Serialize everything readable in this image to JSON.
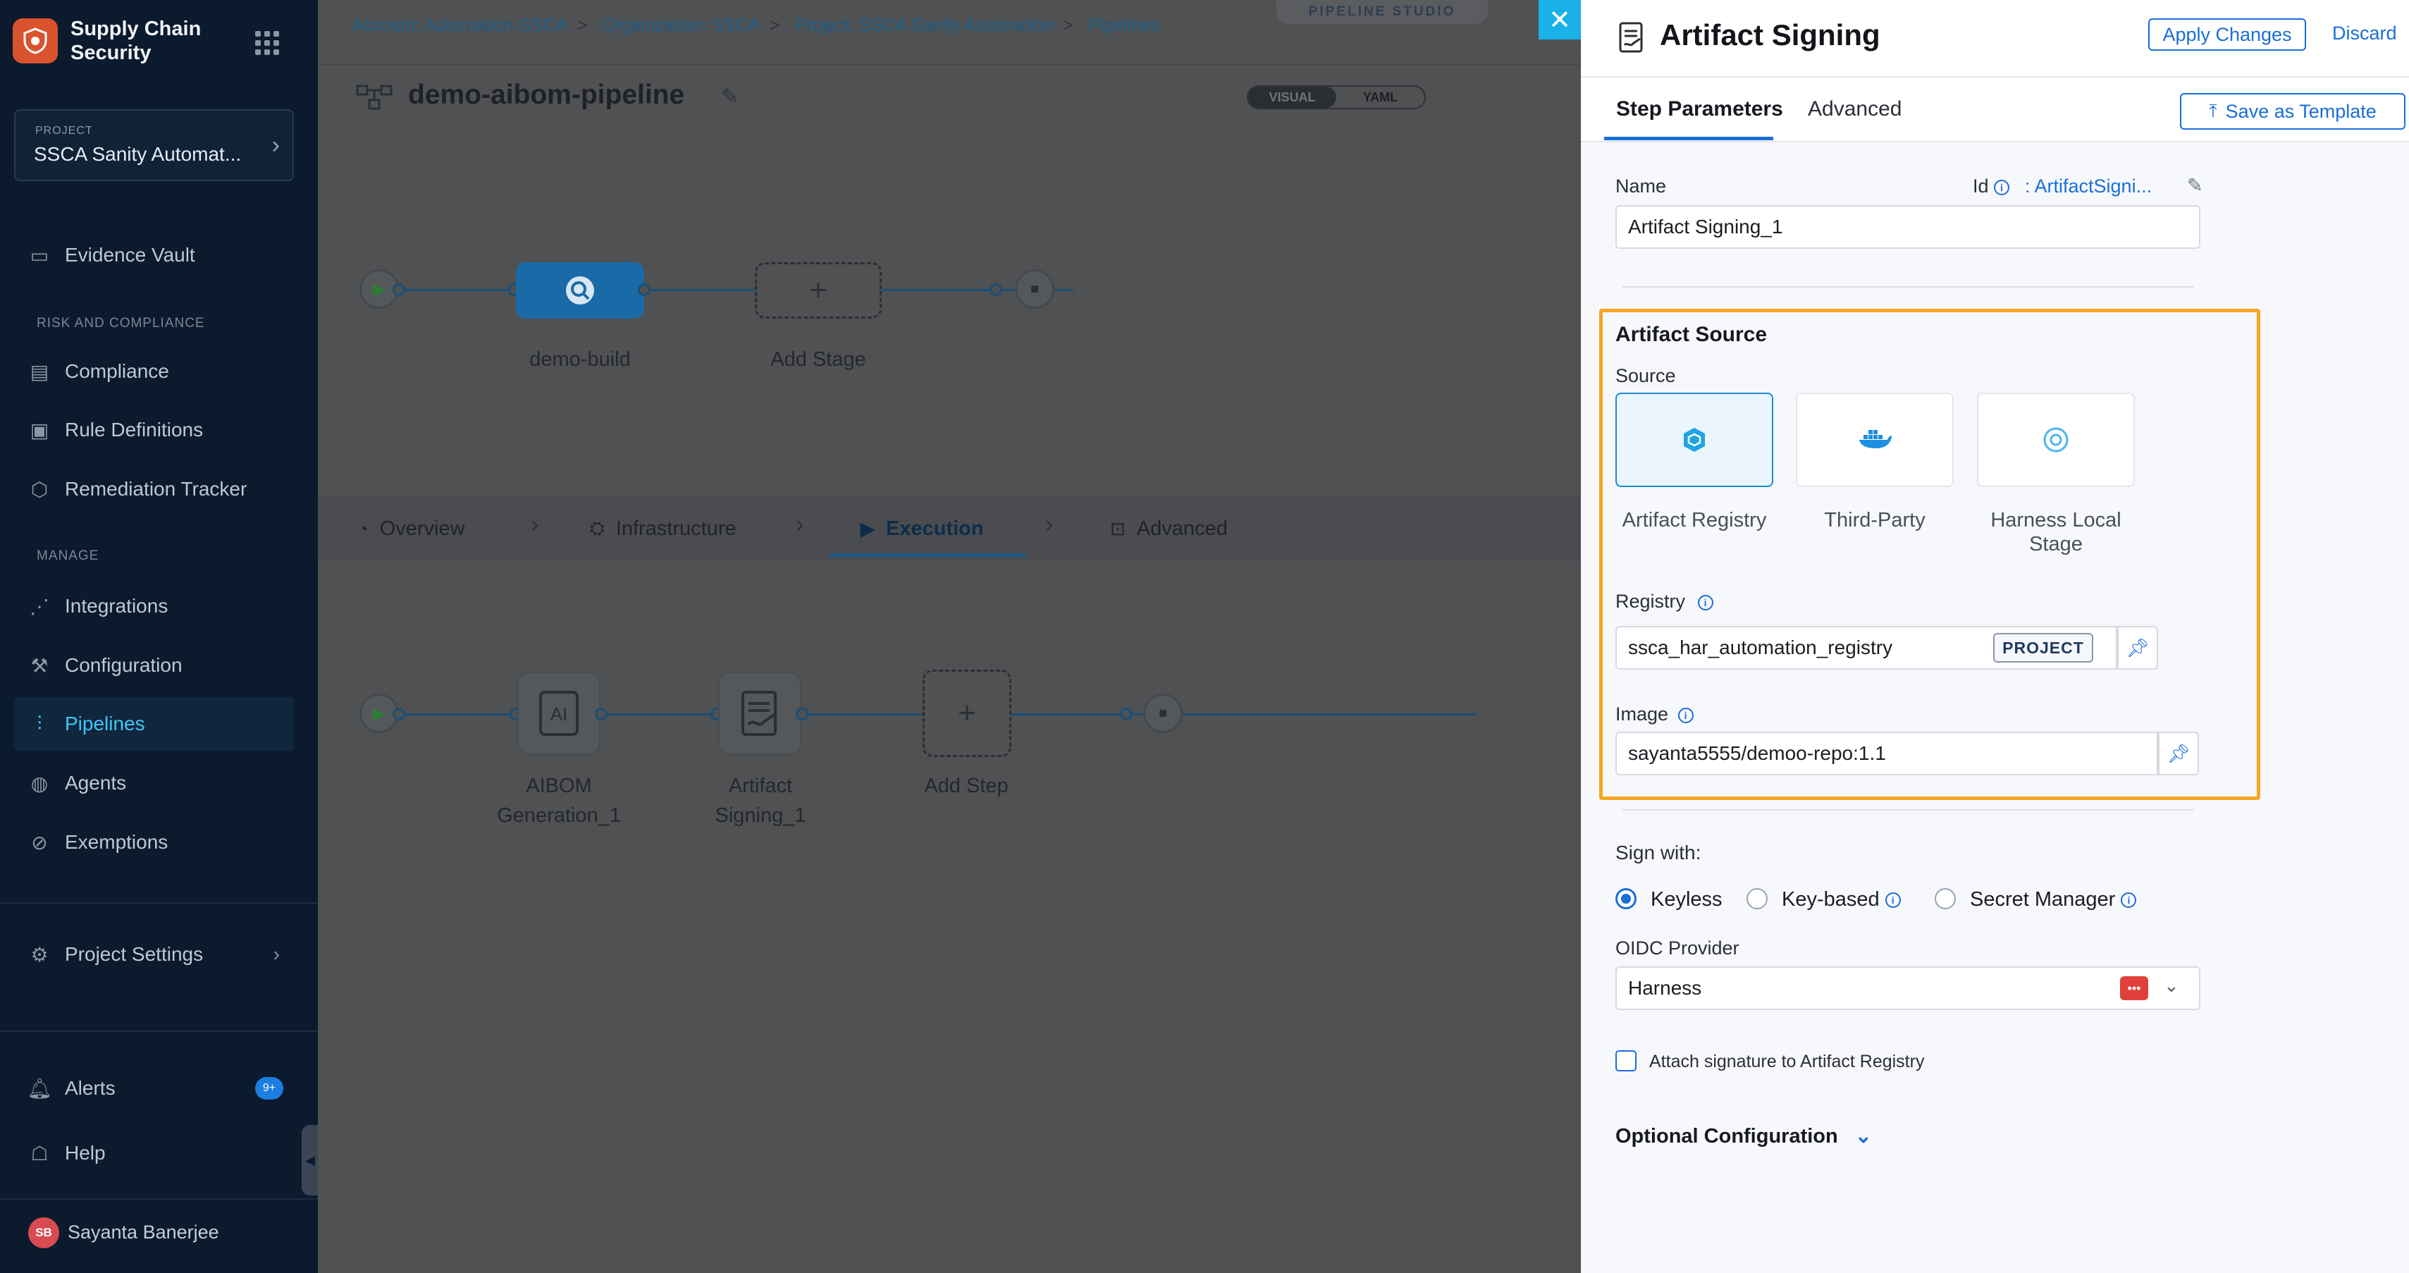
{
  "sidebar": {
    "brand_title": "Supply Chain Security",
    "project_kicker": "PROJECT",
    "project_name": "SSCA Sanity Automat...",
    "items": [
      {
        "label": "Evidence Vault"
      },
      {
        "label": "Compliance"
      },
      {
        "label": "Rule Definitions"
      },
      {
        "label": "Remediation Tracker"
      },
      {
        "label": "Integrations"
      },
      {
        "label": "Configuration"
      },
      {
        "label": "Pipelines"
      },
      {
        "label": "Agents"
      },
      {
        "label": "Exemptions"
      },
      {
        "label": "Project Settings"
      },
      {
        "label": "Alerts"
      },
      {
        "label": "Help"
      }
    ],
    "sections": {
      "risk": "RISK AND COMPLIANCE",
      "manage": "MANAGE"
    },
    "alerts_badge": "9+",
    "user_initials": "SB",
    "user_name": "Sayanta Banerjee"
  },
  "breadcrumb": [
    "Account: Automation-SSCA",
    "Organization: SSCA",
    "Project: SSCA Sanity Automation",
    "Pipelines"
  ],
  "studio_tag": "PIPELINE STUDIO",
  "pipeline": {
    "name": "demo-aibom-pipeline",
    "view_toggle": {
      "visual": "VISUAL",
      "yaml": "YAML"
    },
    "stages": [
      {
        "label": "demo-build"
      },
      {
        "label": "Add Stage"
      }
    ],
    "stage_tabs": [
      "Overview",
      "Infrastructure",
      "Execution",
      "Advanced"
    ],
    "steps": [
      {
        "label_line1": "AIBOM",
        "label_line2": "Generation_1"
      },
      {
        "label_line1": "Artifact",
        "label_line2": "Signing_1"
      },
      {
        "label_line1": "Add Step",
        "label_line2": ""
      }
    ]
  },
  "drawer": {
    "title": "Artifact Signing",
    "apply_label": "Apply Changes",
    "discard_label": "Discard",
    "tabs": [
      "Step Parameters",
      "Advanced"
    ],
    "save_template_label": "Save as Template",
    "name_label": "Name",
    "id_label": "Id",
    "id_value": ": ArtifactSigni...",
    "name_value": "Artifact Signing_1",
    "artifact_source": {
      "heading": "Artifact Source",
      "source_label": "Source",
      "options": [
        {
          "line1": "Artifact Registry",
          "line2": ""
        },
        {
          "line1": "Third-Party",
          "line2": ""
        },
        {
          "line1": "Harness Local",
          "line2": "Stage"
        }
      ],
      "registry_label": "Registry",
      "registry_value": "ssca_har_automation_registry",
      "registry_scope": "PROJECT",
      "image_label": "Image",
      "image_value": "sayanta5555/demoo-repo:1.1"
    },
    "sign_with_label": "Sign with:",
    "sign_options": [
      "Keyless",
      "Key-based",
      "Secret Manager"
    ],
    "oidc_label": "OIDC Provider",
    "oidc_value": "Harness",
    "attach_label": "Attach signature to Artifact Registry",
    "optional_label": "Optional Configuration"
  },
  "colors": {
    "accent": "#1a6ed8",
    "highlight": "#f5a623",
    "sidebar_bg": "#0b1a2c",
    "close_btn": "#1ab0e8"
  }
}
